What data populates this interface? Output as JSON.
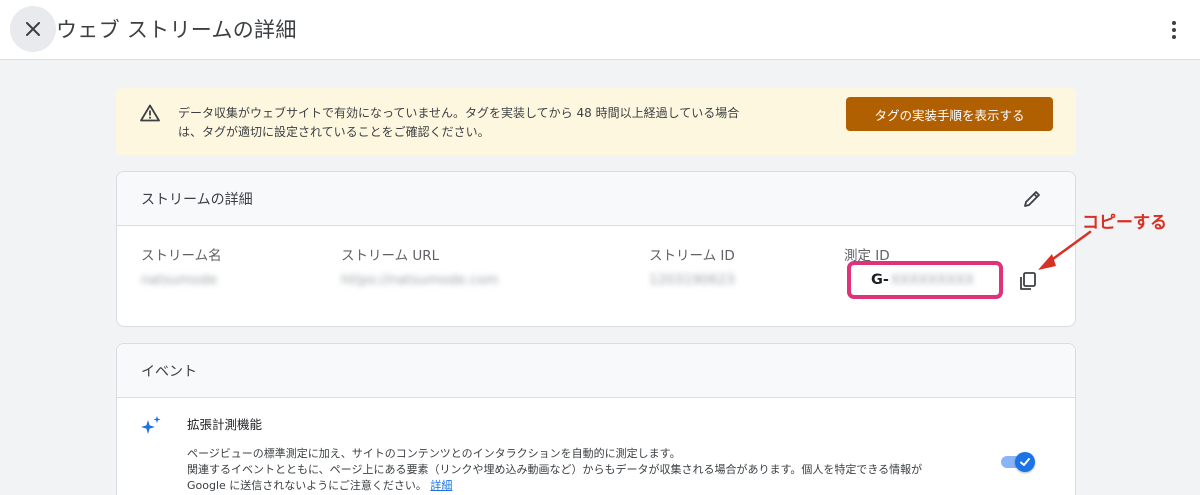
{
  "header": {
    "title": "ウェブ ストリームの詳細",
    "close_icon": "close-icon",
    "more_icon": "more-vert-icon"
  },
  "banner": {
    "icon": "warning-icon",
    "text_line1": "データ収集がウェブサイトで有効になっていません。タグを実装してから 48 時間以上経過している場合",
    "text_line2": "は、タグが適切に設定されていることをご確認ください。",
    "button_label": "タグの実装手順を表示する",
    "background_color": "#fef7e0",
    "button_color": "#b06000"
  },
  "stream_details": {
    "title": "ストリームの詳細",
    "edit_icon": "pencil-icon",
    "name_label": "ストリーム名",
    "name_value": "natsumode",
    "url_label": "ストリーム URL",
    "url_value": "https://natsumode.com",
    "id_label": "ストリーム ID",
    "id_value": "1203190623",
    "measurement_label": "測定 ID",
    "measurement_prefix": "G-",
    "measurement_value": "XXXXXXXXX",
    "copy_icon": "copy-icon",
    "highlight_color": "#e0317b"
  },
  "annotation": {
    "text": "コピーする",
    "color": "#d93025"
  },
  "events": {
    "title": "イベント",
    "enhanced": {
      "icon": "sparkle-icon",
      "title": "拡張計測機能",
      "desc_line1": "ページビューの標準測定に加え、サイトのコンテンツとのインタラクションを自動的に測定します。",
      "desc_line2": "関連するイベントとともに、ページ上にある要素（リンクや埋め込み動画など）からもデータが収集される場合があります。個人を特定できる情報が",
      "desc_line3": "Google に送信されないようにご注意ください。",
      "link": "詳細",
      "toggle_on": true,
      "accent_color": "#1a73e8"
    }
  }
}
